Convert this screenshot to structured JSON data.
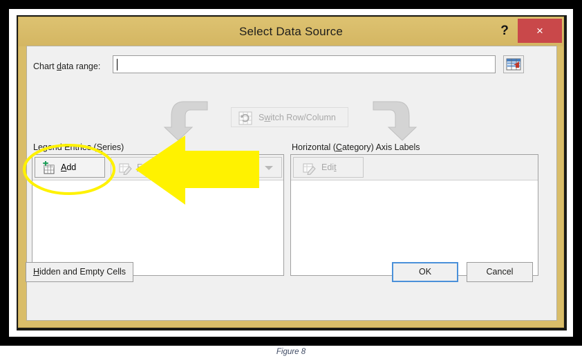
{
  "dialog": {
    "title": "Select Data Source",
    "help_label": "?",
    "close_label": "×"
  },
  "range_row": {
    "label_pre": "Chart ",
    "label_accel": "d",
    "label_post": "ata range:",
    "label_full": "Chart data range:",
    "value": "",
    "placeholder": "",
    "picker_icon": "range-select-icon"
  },
  "switch_button": {
    "label_pre": "S",
    "label_accel": "w",
    "label_post": "itch Row/Column",
    "label_full": "Switch Row/Column",
    "enabled": "false",
    "icon": "switch-row-column-icon"
  },
  "left_panel": {
    "title_pre": "Legend Entries (",
    "title_accel": "S",
    "title_post": "eries)",
    "title_full": "Legend Entries (Series)",
    "buttons": [
      {
        "label_pre": "",
        "label_accel": "A",
        "label_post": "dd",
        "label_full": "Add",
        "enabled": "true",
        "icon": "add-series-icon"
      },
      {
        "label_pre": "",
        "label_accel": "E",
        "label_post": "dit",
        "label_full": "Edit",
        "enabled": "false",
        "icon": "edit-series-icon"
      }
    ],
    "dropdown_icon": "chevron-down-icon",
    "items": []
  },
  "right_panel": {
    "title_pre": "Horizontal (",
    "title_accel": "C",
    "title_post": "ategory) Axis Labels",
    "title_full": "Horizontal (Category) Axis Labels",
    "edit_button": {
      "label_pre": "Edi",
      "label_accel": "t",
      "label_post": "",
      "label_full": "Edit",
      "enabled": "false",
      "icon": "edit-axis-labels-icon"
    },
    "items": []
  },
  "footer": {
    "hidden_pre": "",
    "hidden_accel": "H",
    "hidden_post": "idden and Empty Cells",
    "hidden_full": "Hidden and Empty Cells",
    "ok_label": "OK",
    "cancel_label": "Cancel"
  },
  "annotations": {
    "arrow": "yellow-left-arrow",
    "ellipse": "yellow-highlight-ellipse",
    "color": "#FFF200"
  },
  "caption": {
    "text": "Figure 8"
  },
  "colors": {
    "title_bar": "#d9bd69",
    "close_button": "#c9484a",
    "dialog_body": "#f0f0f0",
    "accent_focus": "#4a90d9",
    "annotation_yellow": "#FFF200",
    "caption_text": "#3f4a63"
  }
}
